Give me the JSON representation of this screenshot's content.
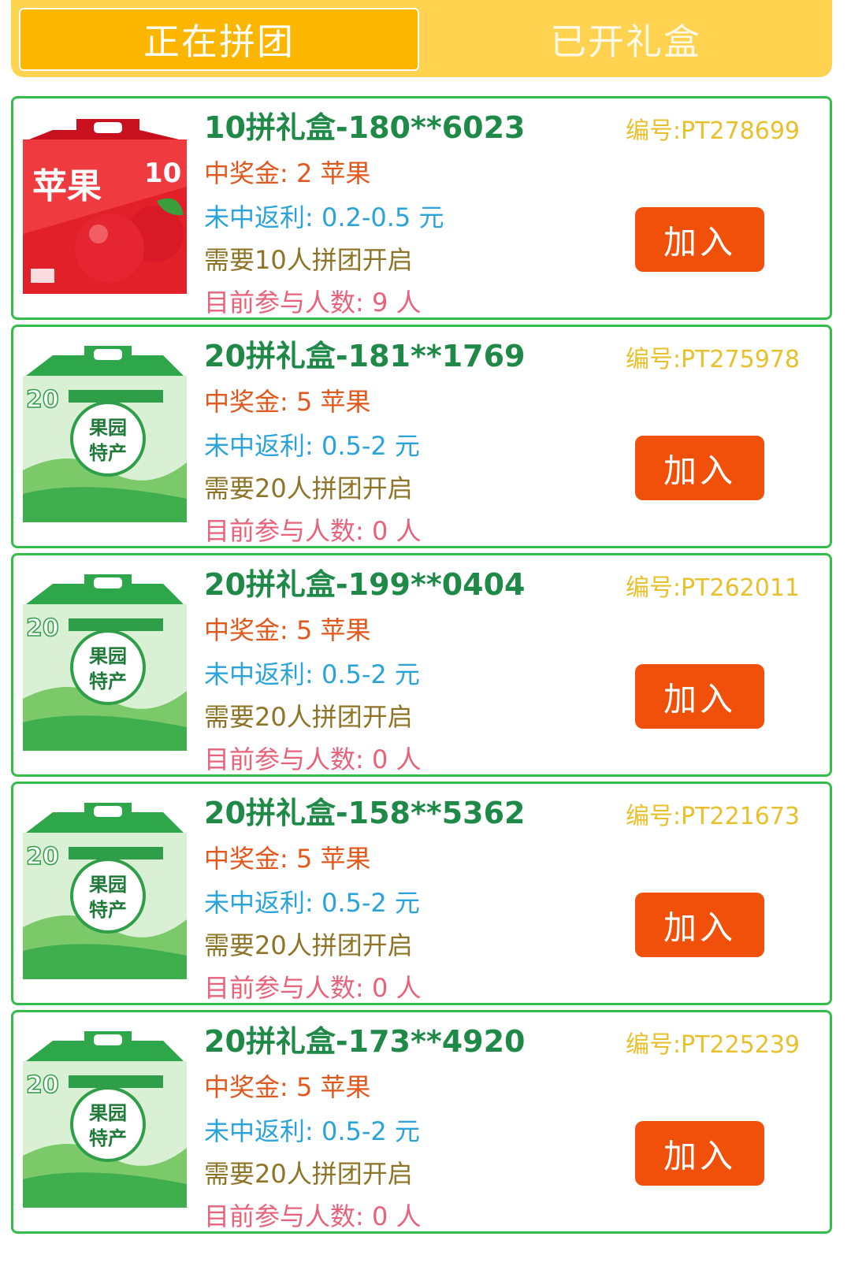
{
  "tabs": {
    "active_label": "正在拼团",
    "inactive_label": "已开礼盒"
  },
  "colors": {
    "tabbar_bg": "#FFD24F",
    "tab_active_bg": "#FCB600",
    "card_border": "#35BD4C",
    "title": "#1F8A48",
    "serial": "#E8C02C",
    "prize": "#E2581C",
    "rebate": "#2AA3DB",
    "need": "#8E7427",
    "count": "#E8627A",
    "join_button": "#F0500A"
  },
  "cards": [
    {
      "image": "red-apple-gift-box",
      "box_number": "10",
      "box_name": "苹果",
      "title": "10拼礼盒-180**6023",
      "serial": "编号:PT278699",
      "prize": "中奖金: 2 苹果",
      "rebate": "未中返利: 0.2-0.5 元",
      "need": "需要10人拼团开启",
      "count": "目前参与人数: 9 人",
      "button": "加入"
    },
    {
      "image": "green-orchard-gift-box",
      "box_number": "20",
      "box_name": "果园特产",
      "title": "20拼礼盒-181**1769",
      "serial": "编号:PT275978",
      "prize": "中奖金: 5 苹果",
      "rebate": "未中返利: 0.5-2 元",
      "need": "需要20人拼团开启",
      "count": "目前参与人数: 0 人",
      "button": "加入"
    },
    {
      "image": "green-orchard-gift-box",
      "box_number": "20",
      "box_name": "果园特产",
      "title": "20拼礼盒-199**0404",
      "serial": "编号:PT262011",
      "prize": "中奖金: 5 苹果",
      "rebate": "未中返利: 0.5-2 元",
      "need": "需要20人拼团开启",
      "count": "目前参与人数: 0 人",
      "button": "加入"
    },
    {
      "image": "green-orchard-gift-box",
      "box_number": "20",
      "box_name": "果园特产",
      "title": "20拼礼盒-158**5362",
      "serial": "编号:PT221673",
      "prize": "中奖金: 5 苹果",
      "rebate": "未中返利: 0.5-2 元",
      "need": "需要20人拼团开启",
      "count": "目前参与人数: 0 人",
      "button": "加入"
    },
    {
      "image": "green-orchard-gift-box",
      "box_number": "20",
      "box_name": "果园特产",
      "title": "20拼礼盒-173**4920",
      "serial": "编号:PT225239",
      "prize": "中奖金: 5 苹果",
      "rebate": "未中返利: 0.5-2 元",
      "need": "需要20人拼团开启",
      "count": "目前参与人数: 0 人",
      "button": "加入"
    }
  ]
}
